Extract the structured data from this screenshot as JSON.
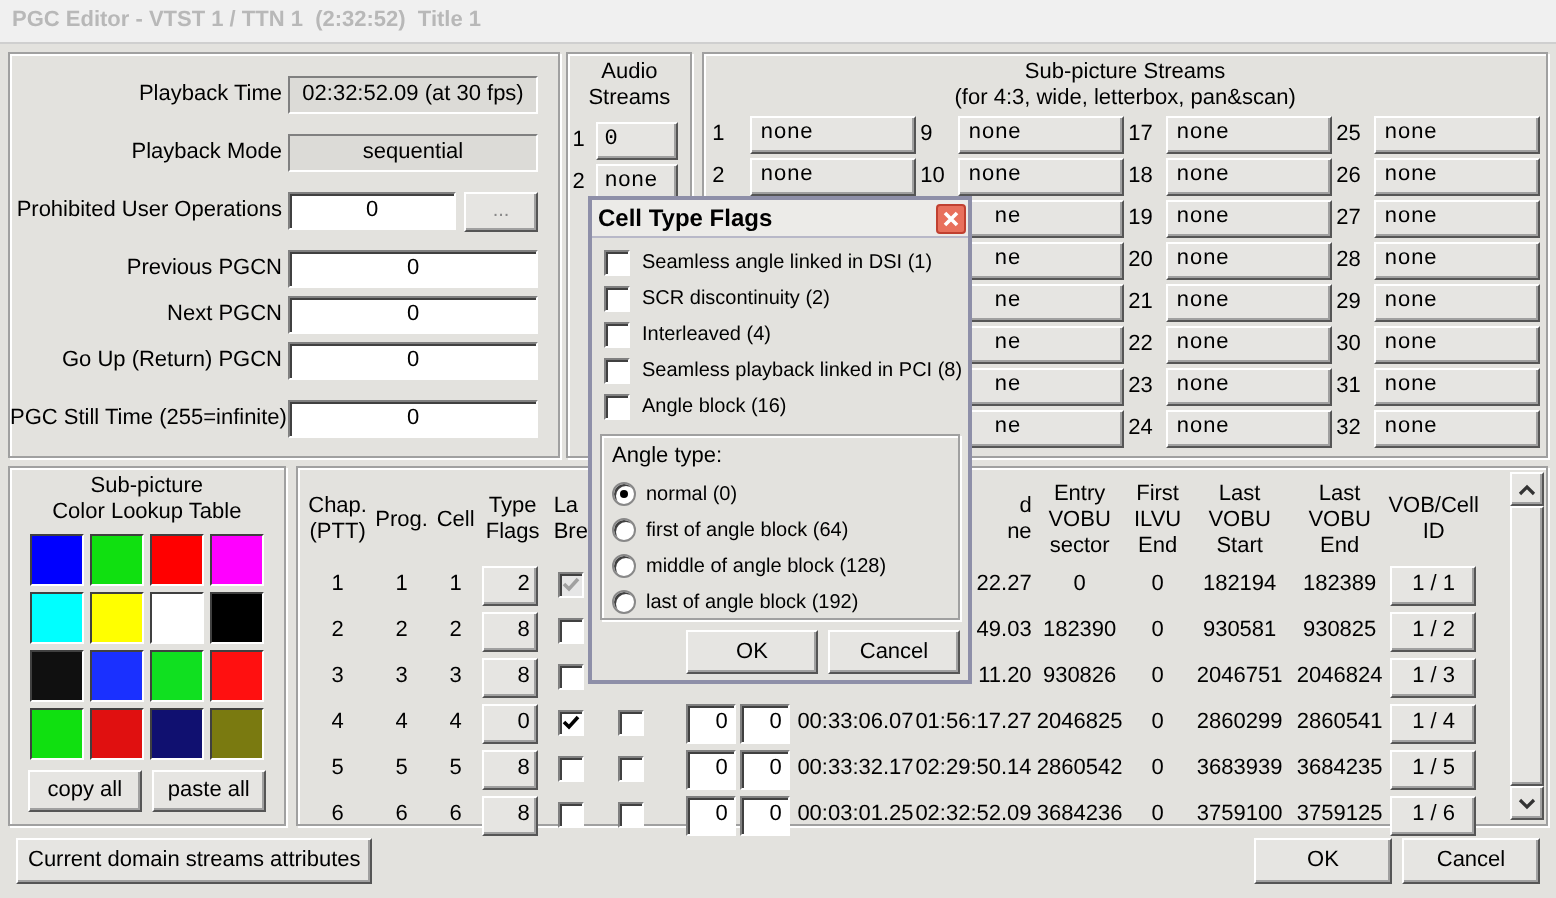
{
  "window": {
    "title": "PGC Editor - VTST 1 / TTN 1  (2:32:52)  Title 1"
  },
  "properties": [
    {
      "label": "Playback Time",
      "value": "02:32:52.09 (at 30 fps)",
      "kind": "readonly"
    },
    {
      "label": "Playback Mode",
      "value": "sequential",
      "kind": "readonly"
    },
    {
      "label": "Prohibited User Operations",
      "value": "0",
      "kind": "field_with_button",
      "button": "..."
    },
    {
      "label": "Previous PGCN",
      "value": "0",
      "kind": "field"
    },
    {
      "label": "Next PGCN",
      "value": "0",
      "kind": "field"
    },
    {
      "label": "Go Up (Return) PGCN",
      "value": "0",
      "kind": "field"
    },
    {
      "label": "PGC Still Time (255=infinite)",
      "value": "0",
      "kind": "field"
    }
  ],
  "audio_streams": {
    "title": "Audio\nStreams",
    "items": [
      {
        "number": "1",
        "value": "0"
      },
      {
        "number": "2",
        "value": "none"
      }
    ]
  },
  "subpicture_streams": {
    "title": "Sub-picture Streams\n(for 4:3, wide, letterbox, pan&scan)",
    "columns": [
      [
        {
          "number": "1",
          "value": "none"
        },
        {
          "number": "2",
          "value": "none"
        }
      ],
      [
        {
          "number": "9",
          "value": "none"
        },
        {
          "number": "10",
          "value": "none"
        },
        {
          "value": "ne"
        },
        {
          "value": "ne"
        },
        {
          "value": "ne"
        },
        {
          "value": "ne"
        },
        {
          "value": "ne"
        },
        {
          "value": "ne"
        }
      ],
      [
        {
          "number": "17",
          "value": "none"
        },
        {
          "number": "18",
          "value": "none"
        },
        {
          "number": "19",
          "value": "none"
        },
        {
          "number": "20",
          "value": "none"
        },
        {
          "number": "21",
          "value": "none"
        },
        {
          "number": "22",
          "value": "none"
        },
        {
          "number": "23",
          "value": "none"
        },
        {
          "number": "24",
          "value": "none"
        }
      ],
      [
        {
          "number": "25",
          "value": "none"
        },
        {
          "number": "26",
          "value": "none"
        },
        {
          "number": "27",
          "value": "none"
        },
        {
          "number": "28",
          "value": "none"
        },
        {
          "number": "29",
          "value": "none"
        },
        {
          "number": "30",
          "value": "none"
        },
        {
          "number": "31",
          "value": "none"
        },
        {
          "number": "32",
          "value": "none"
        }
      ]
    ]
  },
  "color_lookup": {
    "title": "Sub-picture\nColor Lookup Table",
    "colors": [
      {
        "color": "#0000ff"
      },
      {
        "color": "#10e010"
      },
      {
        "color": "#ff0000"
      },
      {
        "color": "#ff00ff"
      },
      {
        "color": "#00ffff"
      },
      {
        "color": "#ffff00"
      },
      {
        "color": "#ffffff"
      },
      {
        "color": "#000000"
      },
      {
        "color": "#101010"
      },
      {
        "color": "#1a30ff"
      },
      {
        "color": "#10e020"
      },
      {
        "color": "#ff1010"
      },
      {
        "color": "#10e010"
      },
      {
        "color": "#e01010"
      },
      {
        "color": "#101070"
      },
      {
        "color": "#7a7a10"
      }
    ],
    "buttons": [
      "copy all",
      "paste all"
    ]
  },
  "cells": {
    "headers": {
      "chapter": "Chap.\n(PTT)",
      "program": "Prog.",
      "cell": "Cell",
      "type_flags": "Type\nFlags",
      "column_5": "La\nBre",
      "column_10": "d\nne",
      "entry_vobu_sector": "Entry\nVOBU\nsector",
      "first_ilvu_end": "First\nILVU\nEnd",
      "last_vobu_start": "Last\nVOBU\nStart",
      "last_vobu_end": "Last\nVOBU\nEnd",
      "vob_cell_id": "VOB/Cell\nID"
    },
    "rows": [
      {
        "chapter": "1",
        "program": "1",
        "cell": "1",
        "type_flags": "2",
        "column_5": {
          "checked": true,
          "disabled": true
        },
        "column_10": "22.27",
        "entry_vobu_sector": "0",
        "first_ilvu_end": "0",
        "last_vobu_start": "182194",
        "last_vobu_end": "182389",
        "vob_cell_id": "1 / 1"
      },
      {
        "chapter": "2",
        "program": "2",
        "cell": "2",
        "type_flags": "8",
        "column_5": {
          "checked": false,
          "disabled": false
        },
        "column_10": "49.03",
        "entry_vobu_sector": "182390",
        "first_ilvu_end": "0",
        "last_vobu_start": "930581",
        "last_vobu_end": "930825",
        "vob_cell_id": "1 / 2"
      },
      {
        "chapter": "3",
        "program": "3",
        "cell": "3",
        "type_flags": "8",
        "column_5": {
          "checked": false,
          "disabled": false
        },
        "column_10": "11.20",
        "entry_vobu_sector": "930826",
        "first_ilvu_end": "0",
        "last_vobu_start": "2046751",
        "last_vobu_end": "2046824",
        "vob_cell_id": "1 / 3"
      },
      {
        "chapter": "4",
        "program": "4",
        "cell": "4",
        "type_flags": "0",
        "column_5": {
          "checked": true,
          "disabled": false
        },
        "column_6": {
          "checked": false
        },
        "column_7": "0",
        "column_8": "0",
        "column_9": "00:33:06.07",
        "column_10": "01:56:17.27",
        "entry_vobu_sector": "2046825",
        "first_ilvu_end": "0",
        "last_vobu_start": "2860299",
        "last_vobu_end": "2860541",
        "vob_cell_id": "1 / 4"
      },
      {
        "chapter": "5",
        "program": "5",
        "cell": "5",
        "type_flags": "8",
        "column_5": {
          "checked": false,
          "disabled": false
        },
        "column_6": {
          "checked": false
        },
        "column_7": "0",
        "column_8": "0",
        "column_9": "00:33:32.17",
        "column_10": "02:29:50.14",
        "entry_vobu_sector": "2860542",
        "first_ilvu_end": "0",
        "last_vobu_start": "3683939",
        "last_vobu_end": "3684235",
        "vob_cell_id": "1 / 5"
      },
      {
        "chapter": "6",
        "program": "6",
        "cell": "6",
        "type_flags": "8",
        "column_5": {
          "checked": false,
          "disabled": false
        },
        "column_6": {
          "checked": false
        },
        "column_7": "0",
        "column_8": "0",
        "column_9": "00:03:01.25",
        "column_10": "02:32:52.09",
        "entry_vobu_sector": "3684236",
        "first_ilvu_end": "0",
        "last_vobu_start": "3759100",
        "last_vobu_end": "3759125",
        "vob_cell_id": "1 / 6"
      }
    ]
  },
  "attributes_button": "Current domain streams attributes",
  "buttons": [
    "OK",
    "Cancel"
  ],
  "dialog": {
    "title": "Cell Type Flags",
    "flags": [
      {
        "label": "Seamless angle linked in DSI (1)",
        "checked": false
      },
      {
        "label": "SCR discontinuity (2)",
        "checked": false
      },
      {
        "label": "Interleaved (4)",
        "checked": false
      },
      {
        "label": "Seamless playback linked in PCI (8)",
        "checked": false
      },
      {
        "label": "Angle block (16)",
        "checked": false
      }
    ],
    "angle_type": {
      "label": "Angle type:",
      "options": [
        {
          "label": "normal (0)",
          "selected": true
        },
        {
          "label": "first of angle block (64)",
          "selected": false
        },
        {
          "label": "middle of angle block (128)",
          "selected": false
        },
        {
          "label": "last of angle block (192)",
          "selected": false
        }
      ]
    },
    "buttons": [
      "OK",
      "Cancel"
    ]
  }
}
